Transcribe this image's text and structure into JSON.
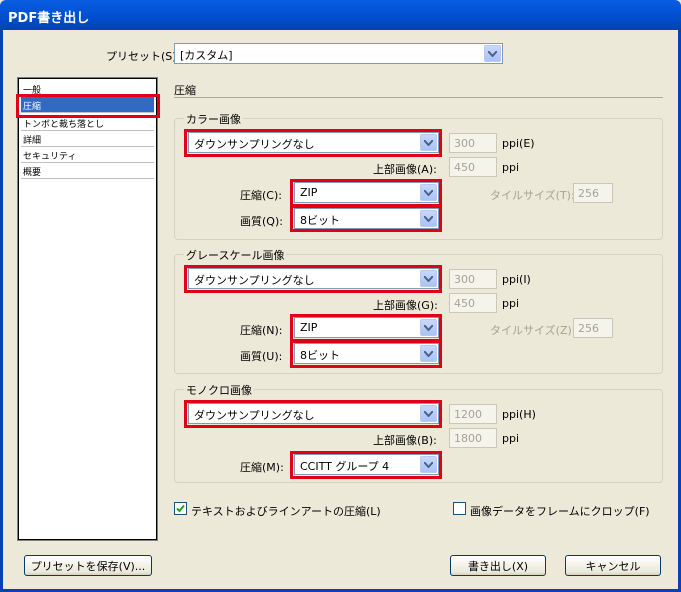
{
  "window": {
    "title": "PDF書き出し"
  },
  "preset": {
    "label": "プリセット(S):",
    "value": "[カスタム]"
  },
  "sidebar": {
    "items": [
      {
        "label": "一般"
      },
      {
        "label": "圧縮"
      },
      {
        "label": "トンボと裁ち落とし"
      },
      {
        "label": "詳細"
      },
      {
        "label": "セキュリティ"
      },
      {
        "label": "概要"
      }
    ],
    "selected": "圧縮"
  },
  "section_title": "圧縮",
  "color": {
    "title": "カラー画像",
    "sampling": "ダウンサンプリングなし",
    "ppi_value": "300",
    "ppi_label": "ppi(E)",
    "above_label": "上部画像(A):",
    "above_value": "450",
    "above_unit": "ppi",
    "comp_label": "圧縮(C):",
    "comp_value": "ZIP",
    "tile_label": "タイルサイズ(T):",
    "tile_value": "256",
    "quality_label": "画質(Q):",
    "quality_value": "8ビット"
  },
  "gray": {
    "title": "グレースケール画像",
    "sampling": "ダウンサンプリングなし",
    "ppi_value": "300",
    "ppi_label": "ppi(I)",
    "above_label": "上部画像(G):",
    "above_value": "450",
    "above_unit": "ppi",
    "comp_label": "圧縮(N):",
    "comp_value": "ZIP",
    "tile_label": "タイルサイズ(Z):",
    "tile_value": "256",
    "quality_label": "画質(U):",
    "quality_value": "8ビット"
  },
  "mono": {
    "title": "モノクロ画像",
    "sampling": "ダウンサンプリングなし",
    "ppi_value": "1200",
    "ppi_label": "ppi(H)",
    "above_label": "上部画像(B):",
    "above_value": "1800",
    "above_unit": "ppi",
    "comp_label": "圧縮(M):",
    "comp_value": "CCITT グループ 4"
  },
  "options": {
    "text_compress": "テキストおよびラインアートの圧縮(L)",
    "text_compress_checked": true,
    "crop": "画像データをフレームにクロップ(F)",
    "crop_checked": false
  },
  "buttons": {
    "save_preset": "プリセットを保存(V)...",
    "export": "書き出し(X)",
    "cancel": "キャンセル"
  }
}
